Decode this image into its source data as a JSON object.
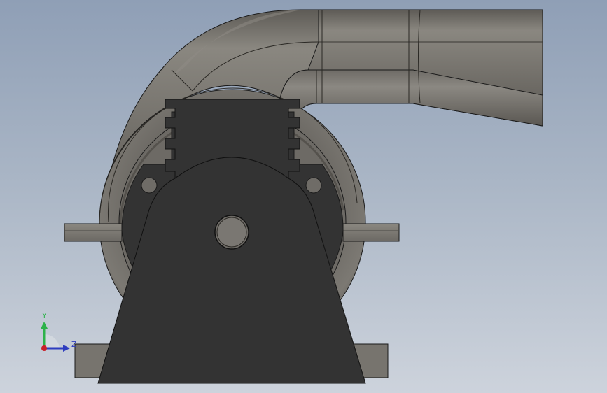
{
  "viewport": {
    "background_top": "#8f9fb6",
    "background_bottom": "#cdd3dc"
  },
  "model": {
    "body_color": "#7a7772",
    "bracket_color": "#333333",
    "edge_color": "#1a1a1a"
  },
  "triad": {
    "y_label": "Y",
    "z_label": "Z",
    "y_color": "#2db24a",
    "z_color": "#2e3dbf",
    "x_color": "#c8202a"
  }
}
